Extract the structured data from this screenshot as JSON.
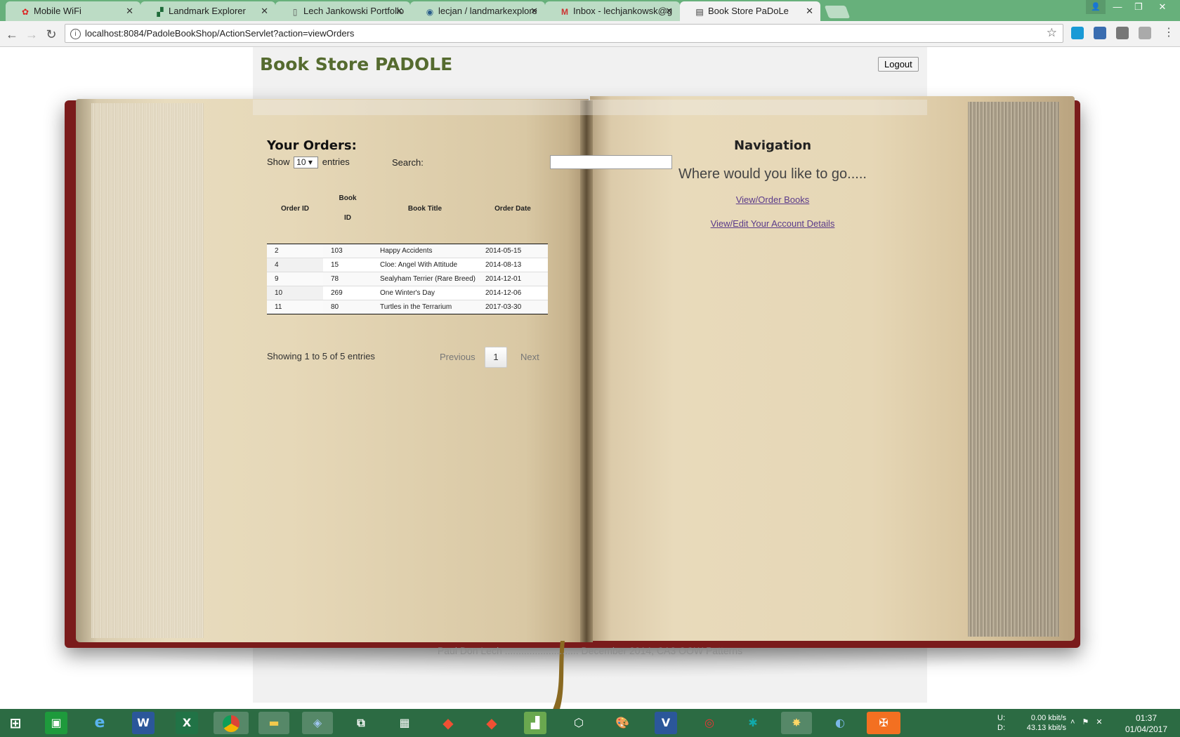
{
  "browser": {
    "tabs": [
      {
        "title": "Mobile WiFi",
        "icon": "huawei-icon",
        "active": false
      },
      {
        "title": "Landmark Explorer",
        "icon": "landmark-icon",
        "active": false
      },
      {
        "title": "Lech Jankowski Portfolio",
        "icon": "page-icon",
        "active": false
      },
      {
        "title": "lecjan / landmarkexplore",
        "icon": "repo-icon",
        "active": false
      },
      {
        "title": "Inbox - lechjankowsk@g",
        "icon": "gmail-icon",
        "active": false
      },
      {
        "title": "Book Store PaDoLe",
        "icon": "book-favicon-icon",
        "active": true
      }
    ],
    "url": "localhost:8084/PadoleBookShop/ActionServlet?action=viewOrders"
  },
  "site": {
    "title": "Book Store PADOLE",
    "logout_label": "Logout"
  },
  "orders": {
    "heading": "Your Orders:",
    "show_label": "Show",
    "page_length": "10",
    "entries_label": "entries",
    "search_label": "Search:",
    "search_value": "",
    "columns": {
      "order_id": "Order ID",
      "book_id_line1": "Book",
      "book_id_line2": "ID",
      "title": "Book Title",
      "date": "Order Date"
    },
    "rows": [
      {
        "order_id": "2",
        "book_id": "103",
        "title": "Happy Accidents",
        "date": "2014-05-15"
      },
      {
        "order_id": "4",
        "book_id": "15",
        "title": "Cloe: Angel With Attitude",
        "date": "2014-08-13"
      },
      {
        "order_id": "9",
        "book_id": "78",
        "title": "Sealyham Terrier (Rare Breed)",
        "date": "2014-12-01"
      },
      {
        "order_id": "10",
        "book_id": "269",
        "title": "One Winter's Day",
        "date": "2014-12-06"
      },
      {
        "order_id": "11",
        "book_id": "80",
        "title": "Turtles in the Terrarium",
        "date": "2017-03-30"
      }
    ],
    "info": "Showing 1 to 5 of 5 entries",
    "pagination": {
      "previous": "Previous",
      "current": "1",
      "next": "Next"
    }
  },
  "navigation": {
    "heading": "Navigation",
    "subheading": "Where would you like to go.....",
    "links": [
      "View/Order Books",
      "View/Edit Your Account Details"
    ]
  },
  "footer": "Paul Don Lech ........................... December 2014, CA3 OOW Patterns",
  "taskbar": {
    "net_labels": "U:\nD:",
    "upload": "0.00 kbit/s",
    "download": "43.13 kbit/s",
    "time": "01:37",
    "date": "01/04/2017"
  },
  "colors": {
    "title": "#556b2f",
    "tabbar": "#67b07b",
    "taskbar": "#2c6b43",
    "link": "#5a3a8a",
    "cover": "#7a1b1b"
  }
}
